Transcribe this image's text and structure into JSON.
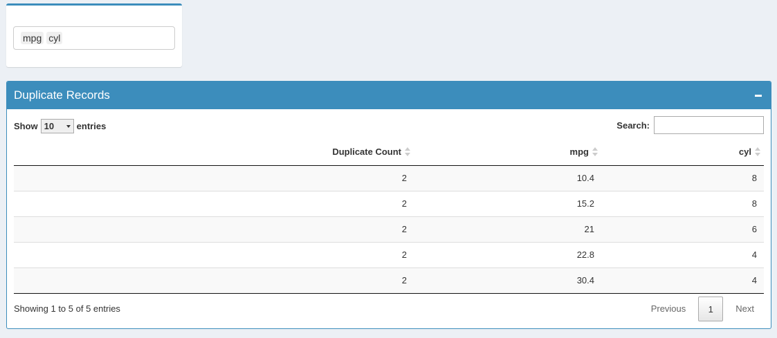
{
  "filter": {
    "selected": [
      "mpg",
      "cyl"
    ]
  },
  "box": {
    "title": "Duplicate Records"
  },
  "length": {
    "show_label": "Show",
    "value": "10",
    "entries_label": "entries"
  },
  "search": {
    "label": "Search:",
    "value": ""
  },
  "table": {
    "columns": [
      "",
      "Duplicate Count",
      "mpg",
      "cyl"
    ],
    "rows": [
      [
        "",
        "2",
        "10.4",
        "8"
      ],
      [
        "",
        "2",
        "15.2",
        "8"
      ],
      [
        "",
        "2",
        "21",
        "6"
      ],
      [
        "",
        "2",
        "22.8",
        "4"
      ],
      [
        "",
        "2",
        "30.4",
        "4"
      ]
    ]
  },
  "info": "Showing 1 to 5 of 5 entries",
  "pagination": {
    "previous": "Previous",
    "current": "1",
    "next": "Next"
  },
  "colors": {
    "accent": "#3c8dbc",
    "background": "#ecf0f5"
  }
}
